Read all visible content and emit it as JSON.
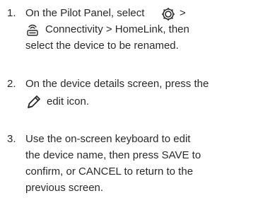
{
  "steps": [
    {
      "number": "1.",
      "line1_text": "On the Pilot Panel, select",
      "line1_after_icon": ">",
      "line2_text": "Connectivity > HomeLink, then",
      "line3_text": "select the device to be renamed."
    },
    {
      "number": "2.",
      "line1_text": "On the device details screen, press the",
      "line2_text": "edit icon."
    },
    {
      "number": "3.",
      "line1_text": "Use the on-screen keyboard to edit",
      "line2_text": "the device name, then press SAVE to",
      "line3_text": "confirm, or CANCEL to return to the",
      "line4_text": "previous screen."
    }
  ],
  "icons": {
    "settings": "gear-icon",
    "connectivity": "connectivity-icon",
    "edit": "pencil-icon"
  }
}
